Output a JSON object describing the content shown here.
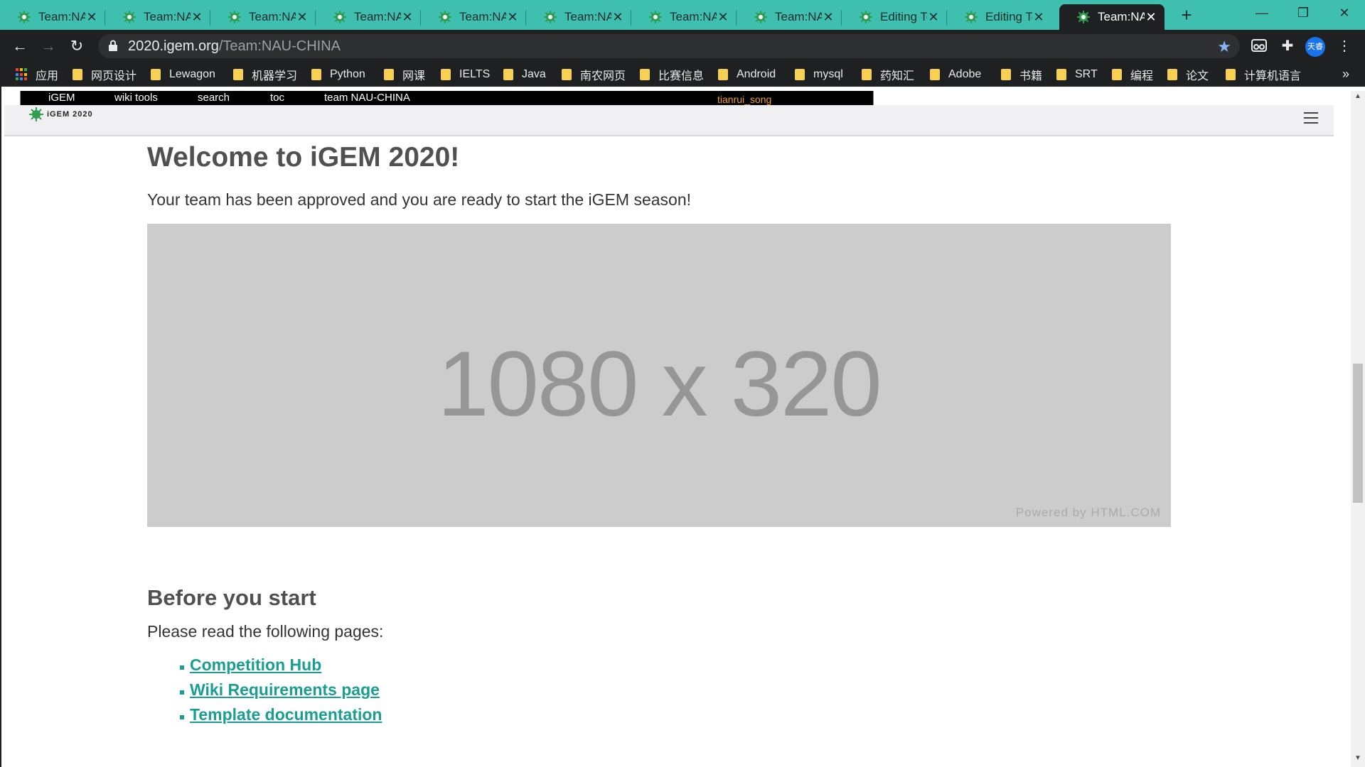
{
  "browser": {
    "tabs": [
      {
        "title": "Team:NAU-CHINA",
        "active": false
      },
      {
        "title": "Team:NAU-CHINA",
        "active": false
      },
      {
        "title": "Team:NAU-CHINA",
        "active": false
      },
      {
        "title": "Team:NAU-CHINA",
        "active": false
      },
      {
        "title": "Team:NAU-CHINA",
        "active": false
      },
      {
        "title": "Team:NAU-CHINA",
        "active": false
      },
      {
        "title": "Team:NAU-CHINA",
        "active": false
      },
      {
        "title": "Team:NAU-CHINA",
        "active": false
      },
      {
        "title": "Editing Team",
        "active": false
      },
      {
        "title": "Editing Team",
        "active": false
      },
      {
        "title": "Team:NAU-CHINA",
        "active": true
      }
    ],
    "url_host": "2020.igem.org",
    "url_path": "/Team:NAU-CHINA",
    "profile_label": "天睿",
    "bookmarks": [
      "应用",
      "网页设计",
      "Lewagon",
      "机器学习",
      "Python",
      "网课",
      "IELTS",
      "Java",
      "南农网页",
      "比赛信息",
      "Android",
      "mysql",
      "药知汇",
      "Adobe",
      "书籍",
      "SRT",
      "编程",
      "论文",
      "计算机语言"
    ],
    "bookmarks_more": "»"
  },
  "wiki_bar": {
    "items": [
      "iGEM",
      "wiki tools",
      "search",
      "toc",
      "team NAU-CHINA"
    ],
    "user": "tianrui_song"
  },
  "header": {
    "logo_text": "iGEM 2020"
  },
  "main": {
    "title": "Welcome to iGEM 2020!",
    "intro": "Your team has been approved and you are ready to start the iGEM season!",
    "placeholder_dims": "1080 x 320",
    "placeholder_powered": "Powered by HTML.COM",
    "before_title": "Before you start",
    "read_text": "Please read the following pages:",
    "links": [
      "Competition Hub",
      "Wiki Requirements page",
      "Template documentation"
    ]
  },
  "colors": {
    "tab_strip": "#3fbfb0",
    "link": "#1a9e92",
    "heading": "#505050",
    "user_name": "#f0a020"
  }
}
